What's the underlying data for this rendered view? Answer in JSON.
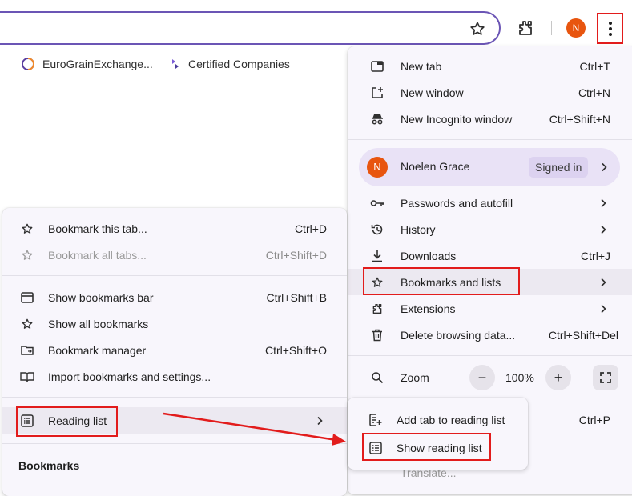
{
  "toolbar": {
    "avatar_initial": "N"
  },
  "bookmarks_bar": {
    "items": [
      {
        "label": "EuroGrainExchange..."
      },
      {
        "label": "Certified Companies"
      }
    ]
  },
  "main_menu": {
    "new_tab": {
      "label": "New tab",
      "shortcut": "Ctrl+T"
    },
    "new_window": {
      "label": "New window",
      "shortcut": "Ctrl+N"
    },
    "new_incognito": {
      "label": "New Incognito window",
      "shortcut": "Ctrl+Shift+N"
    },
    "profile": {
      "initial": "N",
      "name": "Noelen Grace",
      "status": "Signed in"
    },
    "passwords": {
      "label": "Passwords and autofill"
    },
    "history": {
      "label": "History"
    },
    "downloads": {
      "label": "Downloads",
      "shortcut": "Ctrl+J"
    },
    "bookmarks_lists": {
      "label": "Bookmarks and lists"
    },
    "extensions": {
      "label": "Extensions"
    },
    "delete_data": {
      "label": "Delete browsing data...",
      "shortcut": "Ctrl+Shift+Del"
    },
    "zoom": {
      "label": "Zoom",
      "minus": "−",
      "value": "100%",
      "plus": "+"
    },
    "hidden_shortcut": "Ctrl+P",
    "partial_item": "Translate..."
  },
  "bookmarks_menu": {
    "bookmark_tab": {
      "label": "Bookmark this tab...",
      "shortcut": "Ctrl+D"
    },
    "bookmark_all": {
      "label": "Bookmark all tabs...",
      "shortcut": "Ctrl+Shift+D"
    },
    "show_bar": {
      "label": "Show bookmarks bar",
      "shortcut": "Ctrl+Shift+B"
    },
    "show_all": {
      "label": "Show all bookmarks"
    },
    "manager": {
      "label": "Bookmark manager",
      "shortcut": "Ctrl+Shift+O"
    },
    "import": {
      "label": "Import bookmarks and settings..."
    },
    "reading_list": {
      "label": "Reading list"
    },
    "section_title": "Bookmarks"
  },
  "reading_list_menu": {
    "add_tab": {
      "label": "Add tab to reading list"
    },
    "show_list": {
      "label": "Show reading list"
    }
  },
  "colors": {
    "annotation_red": "#e21c1c",
    "avatar_orange": "#e8550f",
    "omnibox_border": "#6b55b5",
    "profile_bg": "#e9e2f6"
  }
}
